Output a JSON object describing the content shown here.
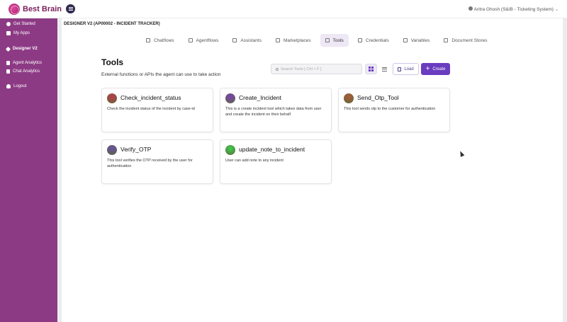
{
  "app": {
    "logo_text": "Best Brain",
    "user_label": "Aritra Ghosh (S&IB - Ticketing System)"
  },
  "sidebar": {
    "items": [
      {
        "label": "Get Started",
        "icon": "gear-icon"
      },
      {
        "label": "My Apps",
        "icon": "apps-icon"
      },
      {
        "label": "Designer V2",
        "icon": "designer-icon"
      },
      {
        "label": "Agent Analytics",
        "icon": "document-icon"
      },
      {
        "label": "Chat Analytics",
        "icon": "document-icon"
      },
      {
        "label": "Logout",
        "icon": "user-icon"
      }
    ]
  },
  "breadcrumb": "DESIGNER V2 (AP00002 - INCIDENT TRACKER)",
  "tabs": [
    {
      "label": "Chatflows",
      "icon": "chatflow-icon"
    },
    {
      "label": "Agentflows",
      "icon": "agentflow-icon"
    },
    {
      "label": "Assistants",
      "icon": "assistant-icon"
    },
    {
      "label": "Marketplaces",
      "icon": "marketplace-icon"
    },
    {
      "label": "Tools",
      "icon": "tools-icon",
      "active": true
    },
    {
      "label": "Credentials",
      "icon": "lock-icon"
    },
    {
      "label": "Variables",
      "icon": "variables-icon"
    },
    {
      "label": "Document Stores",
      "icon": "document-store-icon"
    }
  ],
  "page": {
    "title": "Tools",
    "subtitle": "External functions or APIs the agent can use to take action"
  },
  "toolbar": {
    "search_placeholder": "Search Tools [ Ctrl + F ]",
    "load_label": "Load",
    "create_label": "Create"
  },
  "colors": {
    "sidebar": "#8d3a85",
    "accent": "#6a3dbf"
  },
  "tools": [
    {
      "name": "Check_incident_status",
      "description": "Check the incident status of the incident by case-id",
      "icon_color": "#c0394b"
    },
    {
      "name": "Create_Incident",
      "description": "This is a create incident tool which takes data from user and create the incident on their behalf",
      "icon_color": "#7e3fb8"
    },
    {
      "name": "Send_Otp_Tool",
      "description": "This tool sends otp to the customer for authentication",
      "icon_color": "#b05a3a"
    },
    {
      "name": "Verify_OTP",
      "description": "This tool verifies the OTP received by the user for authentication",
      "icon_color": "#6a4fa8"
    },
    {
      "name": "update_note_to_incident",
      "description": "User can add note to any incident",
      "icon_color": "#3fcf4f"
    }
  ]
}
